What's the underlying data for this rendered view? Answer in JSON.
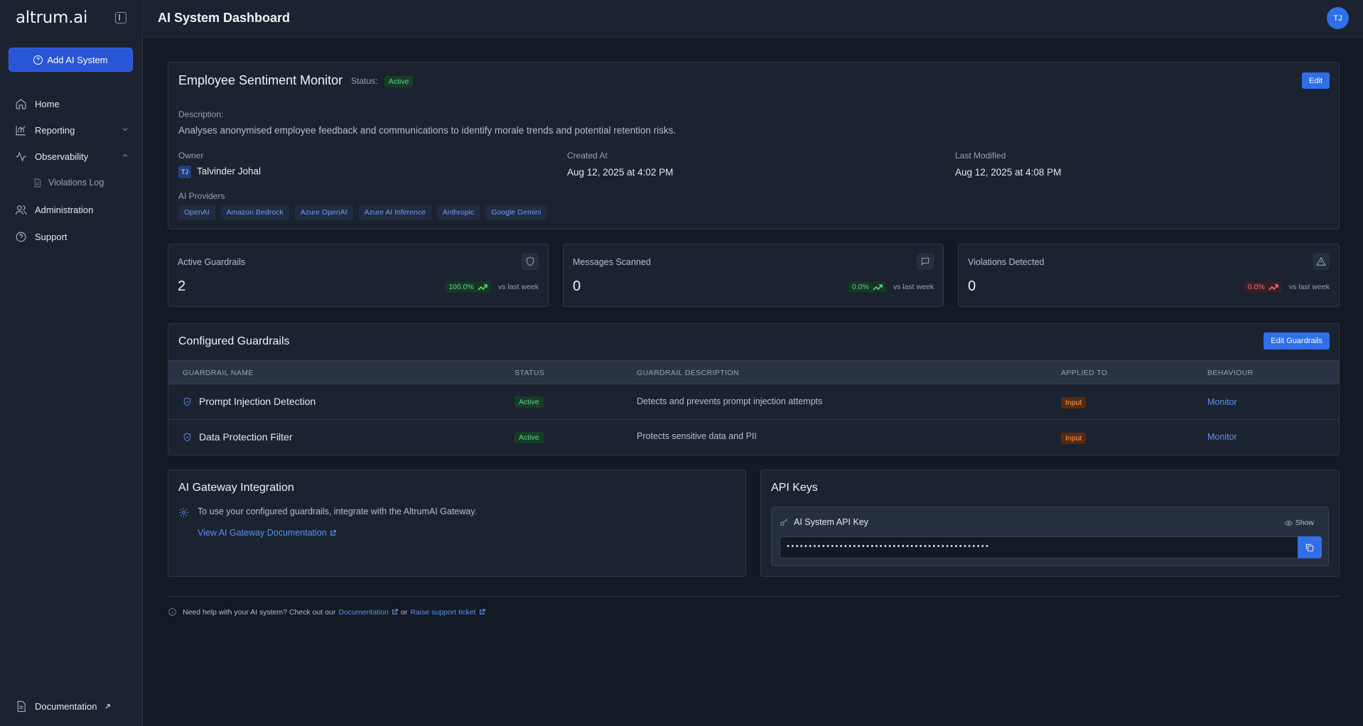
{
  "sidebar": {
    "logo": "altrum.ai",
    "add_button": "Add AI System",
    "items": [
      {
        "label": "Home",
        "icon": "home-icon"
      },
      {
        "label": "Reporting",
        "icon": "chart-icon"
      },
      {
        "label": "Observability",
        "icon": "activity-icon"
      },
      {
        "label": "Administration",
        "icon": "users-icon"
      },
      {
        "label": "Support",
        "icon": "help-icon"
      }
    ],
    "sub_item": "Violations Log",
    "documentation": "Documentation"
  },
  "header": {
    "title": "AI System Dashboard",
    "avatar": "TJ"
  },
  "system": {
    "name": "Employee Sentiment Monitor",
    "status_label": "Status:",
    "status": "Active",
    "edit": "Edit",
    "description_label": "Description:",
    "description": "Analyses anonymised employee feedback and communications to identify morale trends and potential retention risks.",
    "owner_label": "Owner",
    "owner_initials": "TJ",
    "owner": "Talvinder Johal",
    "created_label": "Created At",
    "created": "Aug 12, 2025 at 4:02 PM",
    "modified_label": "Last Modified",
    "modified": "Aug 12, 2025 at 4:08 PM",
    "providers_label": "AI Providers",
    "providers": [
      "OpenAI",
      "Amazon Bedrock",
      "Azure OpenAI",
      "Azure AI Inference",
      "Anthropic",
      "Google Gemini"
    ]
  },
  "stats": [
    {
      "title": "Active Guardrails",
      "value": "2",
      "change": "100.0%",
      "trend": "up",
      "compare": "vs last week",
      "icon": "shield-icon"
    },
    {
      "title": "Messages Scanned",
      "value": "0",
      "change": "0.0%",
      "trend": "up",
      "compare": "vs last week",
      "icon": "message-icon"
    },
    {
      "title": "Violations Detected",
      "value": "0",
      "change": "0.0%",
      "trend": "down",
      "compare": "vs last week",
      "icon": "warning-icon"
    }
  ],
  "guardrails": {
    "title": "Configured Guardrails",
    "edit_button": "Edit Guardrails",
    "columns": [
      "GUARDRAIL NAME",
      "STATUS",
      "GUARDRAIL DESCRIPTION",
      "APPLIED TO",
      "BEHAVIOUR"
    ],
    "rows": [
      {
        "name": "Prompt Injection Detection",
        "status": "Active",
        "description": "Detects and prevents prompt injection attempts",
        "applied_to": "Input",
        "behaviour": "Monitor"
      },
      {
        "name": "Data Protection Filter",
        "status": "Active",
        "description": "Protects sensitive data and PII",
        "applied_to": "Input",
        "behaviour": "Monitor"
      }
    ]
  },
  "gateway": {
    "title": "AI Gateway Integration",
    "text": "To use your configured guardrails, integrate with the AltrumAI Gateway.",
    "link": "View AI Gateway Documentation"
  },
  "api": {
    "title": "API Keys",
    "key_label": "AI System API Key",
    "show": "Show",
    "masked": "••••••••••••••••••••••••••••••••••••••••••••••"
  },
  "footer": {
    "text": "Need help with your AI system? Check out our",
    "doc_link": "Documentation",
    "or": "or",
    "ticket_link": "Raise support ticket"
  },
  "colors": {
    "accent": "#2f6fe9",
    "success": "#5fd68a",
    "danger": "#f0717f",
    "warning": "#f2a05c"
  }
}
